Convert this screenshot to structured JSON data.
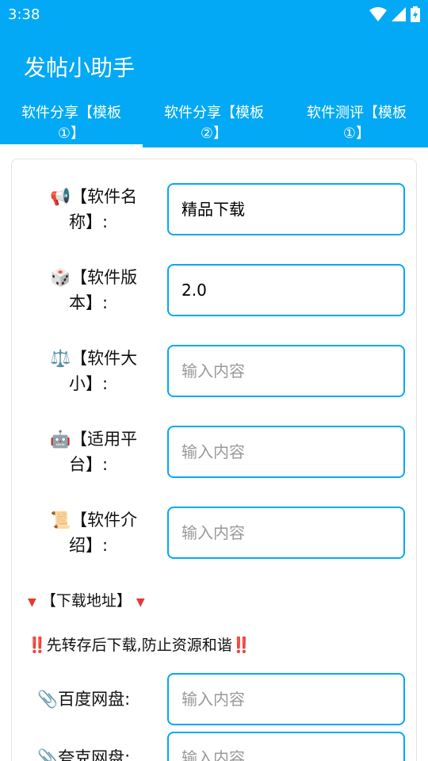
{
  "status": {
    "time": "3:38"
  },
  "app": {
    "title": "发帖小助手"
  },
  "tabs": [
    {
      "line1": "软件分享【模板",
      "line2": "①】"
    },
    {
      "line1": "软件分享【模板",
      "line2": "②】"
    },
    {
      "line1": "软件测评【模板",
      "line2": "①】"
    }
  ],
  "fields": [
    {
      "emoji": "📢",
      "line1": "【软件名",
      "line2": "称】:",
      "value": "精品下载",
      "placeholder": ""
    },
    {
      "emoji": "🎲",
      "line1": "【软件版",
      "line2": "本】:",
      "value": "2.0",
      "placeholder": ""
    },
    {
      "emoji": "⚖️",
      "line1": "【软件大",
      "line2": "小】:",
      "value": "",
      "placeholder": "输入内容"
    },
    {
      "emoji": "🤖",
      "line1": "【适用平",
      "line2": "台】:",
      "value": "",
      "placeholder": "输入内容"
    },
    {
      "emoji": "📜",
      "line1": "【软件介",
      "line2": "绍】:",
      "value": "",
      "placeholder": "输入内容"
    }
  ],
  "download": {
    "header": "【下载地址】",
    "notice": "先转存后下载,防止资源和谐",
    "notice_mark": "‼️",
    "links": [
      {
        "emoji": "📎",
        "label": "百度网盘:",
        "placeholder": "输入内容"
      },
      {
        "emoji": "📎",
        "label": "夸克网盘:",
        "placeholder": "输入内容"
      }
    ]
  },
  "colors": {
    "primary": "#03a9f4",
    "accent_red": "#e53935"
  }
}
